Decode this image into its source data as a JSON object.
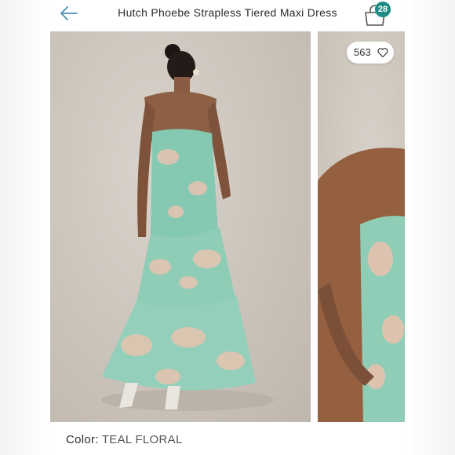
{
  "header": {
    "title": "Hutch Phoebe Strapless Tiered Maxi Dress",
    "bag_count": "28"
  },
  "gallery": {
    "like_count": "563"
  },
  "product": {
    "color_label": "Color:",
    "color_value": "TEAL FLORAL"
  },
  "colors": {
    "accent": "#1f8b86",
    "dress_teal": "#7cc9b4",
    "dress_pink": "#e8c2ae"
  },
  "icons": {
    "back": "back-arrow-icon",
    "bag": "shopping-bag-icon",
    "like": "heart-icon"
  }
}
